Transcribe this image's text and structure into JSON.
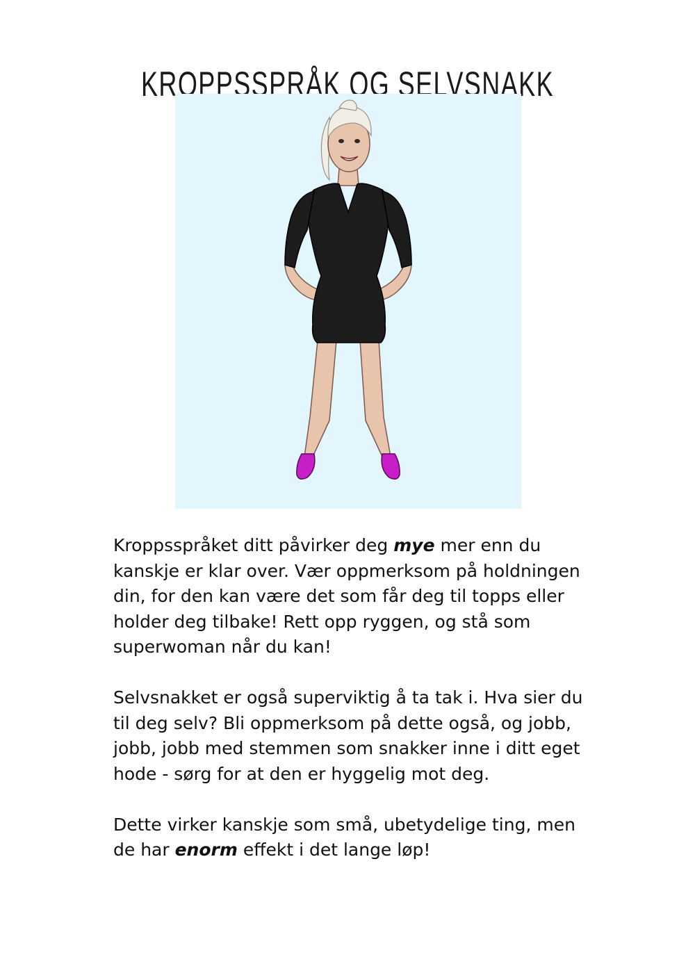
{
  "document": {
    "title": "KROPPSSPRÅK OG SELVSNAKK",
    "illustration": {
      "subject": "woman-standing-hands-on-hips",
      "colors": {
        "background": "#e3f6fd",
        "dress": "#1c1c1c",
        "skin": "#e8c4ad",
        "hair": "#f1eee6",
        "shoes": "#c81ec8"
      }
    },
    "paragraphs": [
      {
        "before": "Kroppsspråket ditt påvirker deg ",
        "emphasis": "mye",
        "after": " mer enn du kanskje er klar over. Vær oppmerksom på holdningen din, for den kan være det som får deg til topps eller holder deg tilbake! Rett opp ryggen, og stå som superwoman når du kan!"
      },
      {
        "text": "Selvsnakket er også superviktig å ta tak i. Hva sier du til deg selv? Bli oppmerksom på dette også, og jobb, jobb, jobb med stemmen som snakker inne i ditt eget hode - sørg for at den er hyggelig mot deg."
      },
      {
        "before": "Dette virker kanskje som små, ubetydelige ting, men de har ",
        "emphasis": "enorm",
        "after": " effekt i det lange løp!"
      }
    ]
  }
}
